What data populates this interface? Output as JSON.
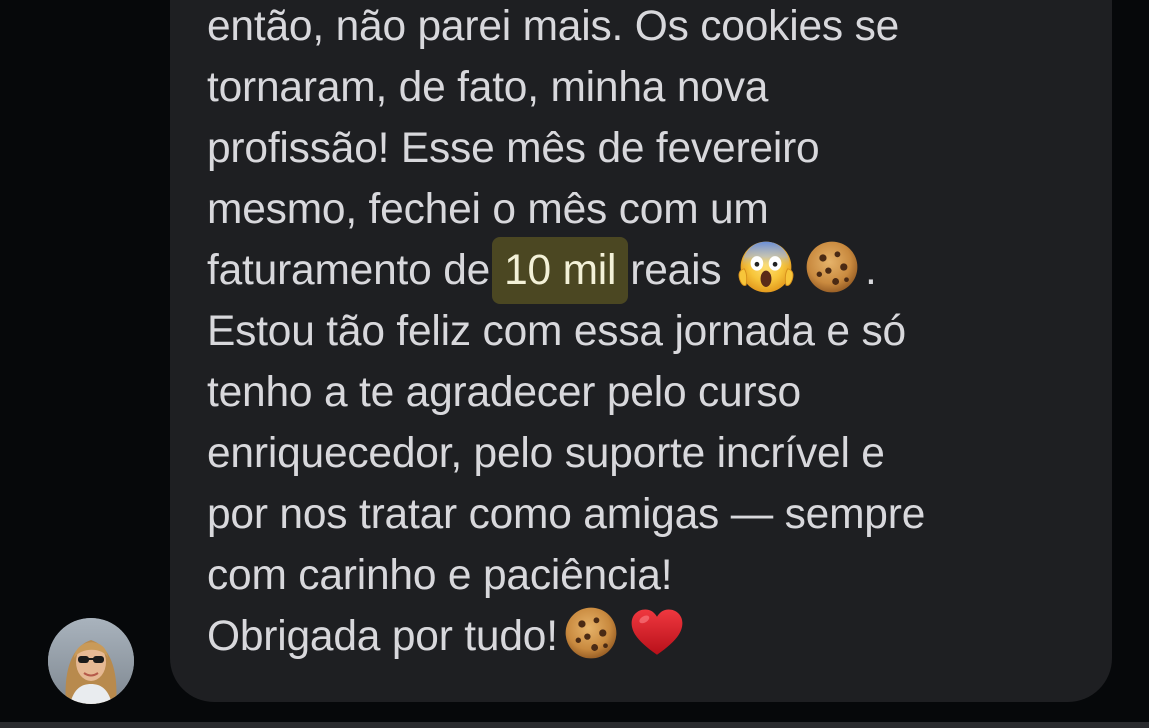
{
  "message": {
    "line1": "então, não parei mais. Os cookies se",
    "line2": "tornaram, de fato, minha nova",
    "line3": "profissão! Esse mês de fevereiro",
    "line4": "mesmo, fechei o mês com um",
    "line5_before": "faturamento de",
    "line5_highlight": "10 mil",
    "line5_after": "reais",
    "line5_end": ".",
    "line6": "Estou tão feliz com essa jornada e só",
    "line7": "tenho a te agradecer pelo curso",
    "line8": "enriquecedor, pelo suporte incrível e",
    "line9": "por nos tratar como amigas — sempre",
    "line10": "com carinho e paciência!",
    "line11": "Obrigada por tudo!"
  },
  "emojis": [
    "screaming-face-icon",
    "cookie-icon",
    "cookie-icon",
    "red-heart-icon"
  ],
  "colors": {
    "background": "#06080a",
    "bubble": "#1e1f22",
    "text": "#d8d8dc",
    "highlight": "#4b4722"
  }
}
